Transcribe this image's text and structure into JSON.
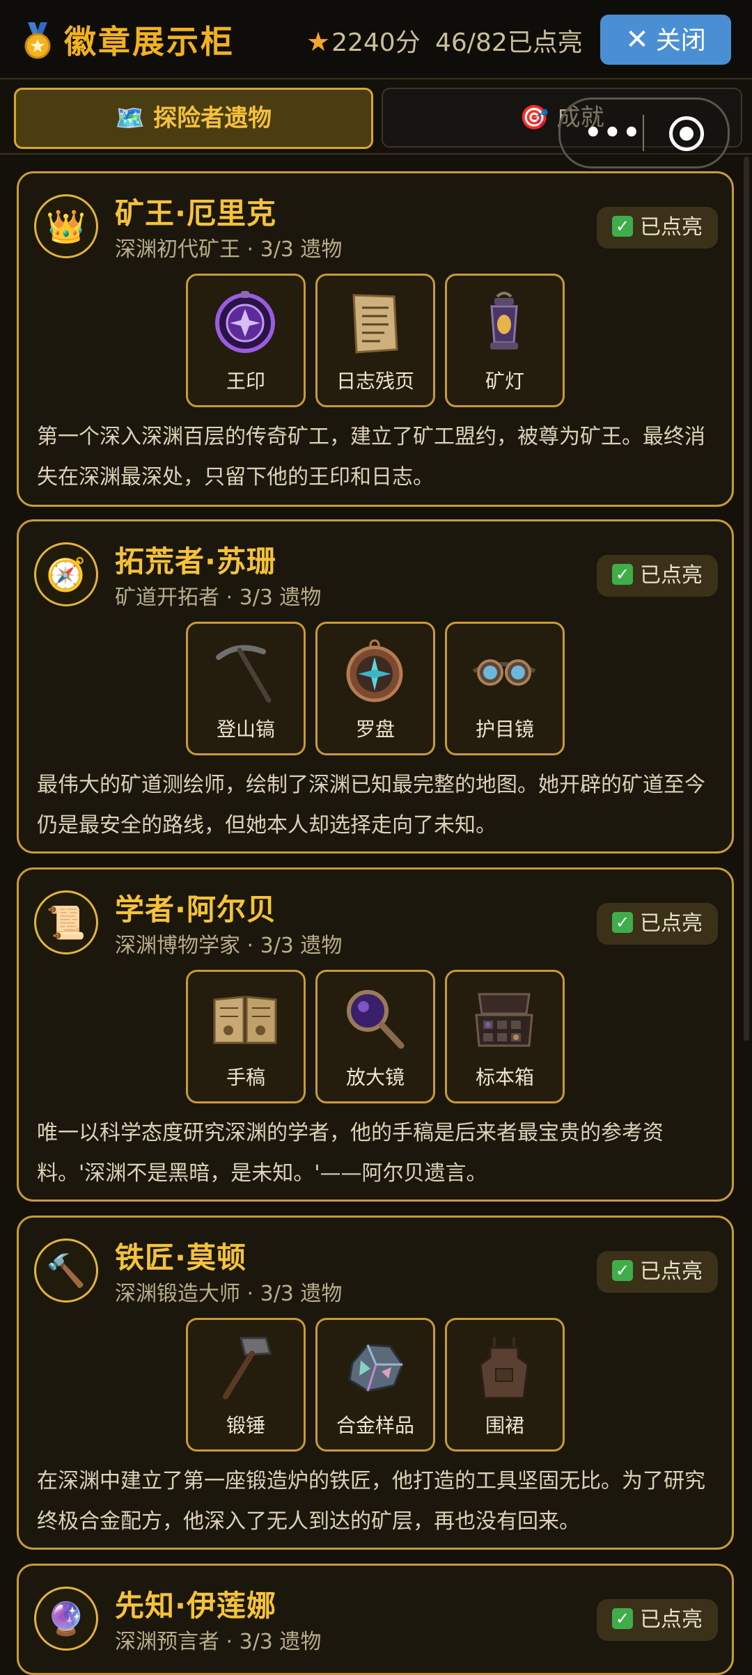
{
  "header": {
    "title": "徽章展示柜",
    "score": "2240分",
    "progress": "46/82已点亮",
    "close_label": "关闭"
  },
  "tabs": [
    {
      "label": "探险者遗物",
      "icon": "map-icon",
      "active": true
    },
    {
      "label": "成就",
      "icon": "target-icon",
      "active": false
    }
  ],
  "cards": [
    {
      "name": "矿王·厄里克",
      "subtitle": "深渊初代矿王 · 3/3 遗物",
      "avatar": "crown-icon",
      "status": "已点亮",
      "items": [
        {
          "label": "王印",
          "icon": "purple-seal-icon"
        },
        {
          "label": "日志残页",
          "icon": "scroll-page-icon"
        },
        {
          "label": "矿灯",
          "icon": "lantern-icon"
        }
      ],
      "description": "第一个深入深渊百层的传奇矿工，建立了矿工盟约，被尊为矿王。最终消失在深渊最深处，只留下他的王印和日志。"
    },
    {
      "name": "拓荒者·苏珊",
      "subtitle": "矿道开拓者 · 3/3 遗物",
      "avatar": "compass-icon",
      "status": "已点亮",
      "items": [
        {
          "label": "登山镐",
          "icon": "pickaxe-icon"
        },
        {
          "label": "罗盘",
          "icon": "compass-item-icon"
        },
        {
          "label": "护目镜",
          "icon": "goggles-icon"
        }
      ],
      "description": "最伟大的矿道测绘师，绘制了深渊已知最完整的地图。她开辟的矿道至今仍是最安全的路线，但她本人却选择走向了未知。"
    },
    {
      "name": "学者·阿尔贝",
      "subtitle": "深渊博物学家 · 3/3 遗物",
      "avatar": "scroll-icon",
      "status": "已点亮",
      "items": [
        {
          "label": "手稿",
          "icon": "manuscript-icon"
        },
        {
          "label": "放大镜",
          "icon": "magnifier-icon"
        },
        {
          "label": "标本箱",
          "icon": "specimen-box-icon"
        }
      ],
      "description": "唯一以科学态度研究深渊的学者，他的手稿是后来者最宝贵的参考资料。'深渊不是黑暗，是未知。'——阿尔贝遗言。"
    },
    {
      "name": "铁匠·莫顿",
      "subtitle": "深渊锻造大师 · 3/3 遗物",
      "avatar": "hammer-icon",
      "status": "已点亮",
      "items": [
        {
          "label": "锻锤",
          "icon": "forge-hammer-icon"
        },
        {
          "label": "合金样品",
          "icon": "alloy-ore-icon"
        },
        {
          "label": "围裙",
          "icon": "apron-icon"
        }
      ],
      "description": "在深渊中建立了第一座锻造炉的铁匠，他打造的工具坚固无比。为了研究终极合金配方，他深入了无人到达的矿层，再也没有回来。"
    },
    {
      "name": "先知·伊莲娜",
      "subtitle": "深渊预言者 · 3/3 遗物",
      "avatar": "crystal-ball-icon",
      "status": "已点亮"
    }
  ]
}
